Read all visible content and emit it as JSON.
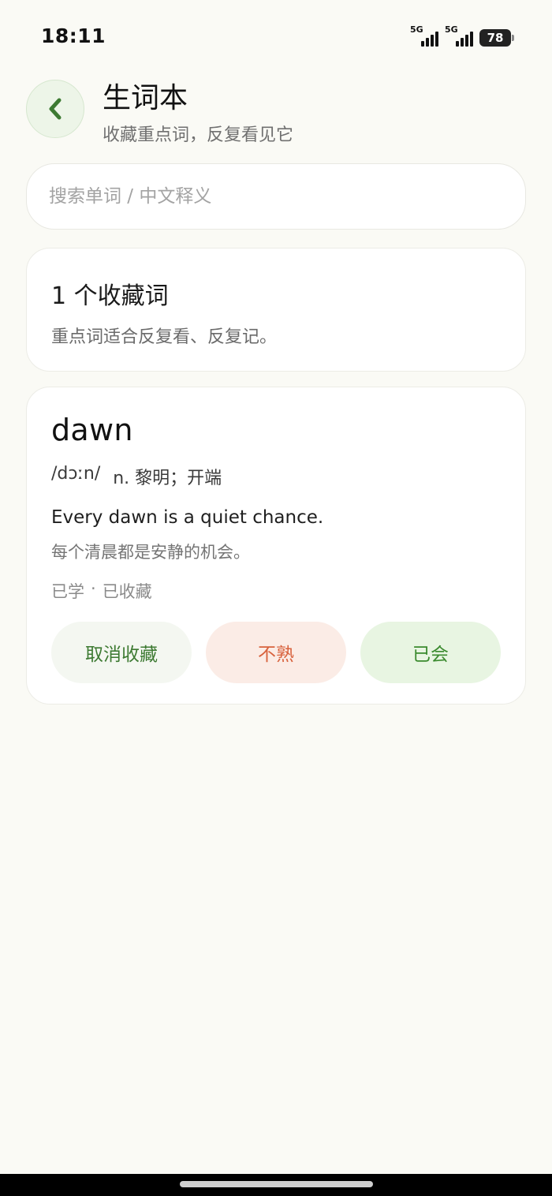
{
  "status_bar": {
    "time": "18:11",
    "network_1": "5G",
    "network_2": "5G",
    "battery": "78"
  },
  "header": {
    "back_icon": "chevron-left-icon",
    "title": "生词本",
    "subtitle": "收藏重点词，反复看见它"
  },
  "search": {
    "placeholder": "搜索单词 / 中文释义",
    "value": ""
  },
  "summary": {
    "count_text": "1 个收藏词",
    "hint": "重点词适合反复看、反复记。"
  },
  "words": [
    {
      "word": "dawn",
      "phonetic": "/dɔːn/",
      "definition": "n. 黎明；开端",
      "example": "Every dawn is a quiet chance.",
      "example_translation": "每个清晨都是安静的机会。",
      "status_learned": "已学",
      "status_separator": "·",
      "status_favorited": "已收藏",
      "actions": {
        "unfavorite": "取消收藏",
        "unfamiliar": "不熟",
        "known": "已会"
      }
    }
  ],
  "colors": {
    "accent_green": "#3d7a32",
    "warning_orange": "#d8623d",
    "background": "#fafaf5"
  }
}
